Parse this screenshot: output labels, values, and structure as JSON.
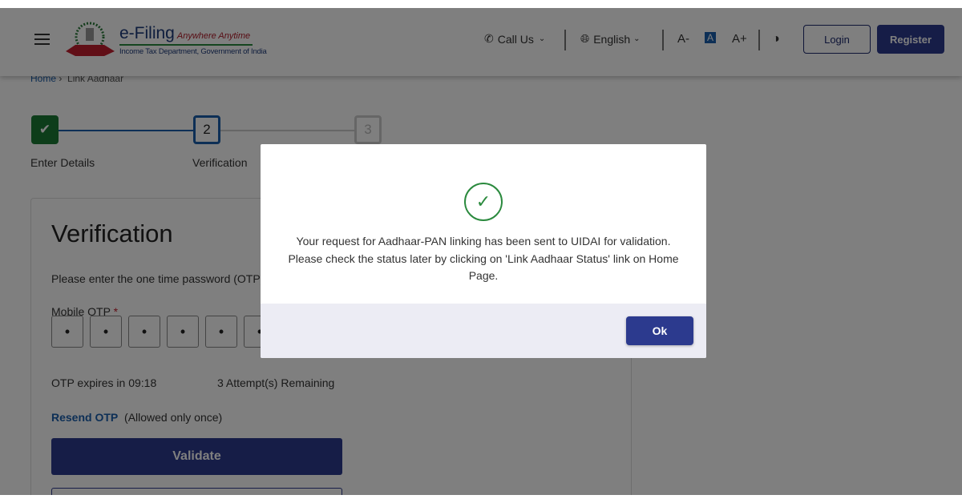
{
  "header": {
    "brand_title": "e-Filing",
    "brand_tagline": "Anywhere Anytime",
    "brand_subtitle": "Income Tax Department, Government of India",
    "call_us": "Call Us",
    "language": "English",
    "font_decrease": "A-",
    "font_normal": "A",
    "font_increase": "A+",
    "login": "Login",
    "register": "Register"
  },
  "breadcrumb": {
    "home": "Home",
    "separator": "›",
    "current": "Link Aadhaar"
  },
  "stepper": {
    "steps": [
      {
        "number": "✔",
        "label": "Enter Details",
        "state": "done"
      },
      {
        "number": "2",
        "label": "Verification",
        "state": "active"
      },
      {
        "number": "3",
        "label": "",
        "state": "pending"
      }
    ]
  },
  "form": {
    "title": "Verification",
    "instruction": "Please enter the one time password (OTP)",
    "otp_label": "Mobile OTP",
    "required_mark": "*",
    "otp_digits": [
      "•",
      "•",
      "•",
      "•",
      "•",
      "•"
    ],
    "expiry": "OTP expires in 09:18",
    "attempts": "3 Attempt(s) Remaining",
    "resend": "Resend OTP",
    "resend_note": "(Allowed only once)",
    "validate": "Validate"
  },
  "modal": {
    "line1": "Your request for Aadhaar-PAN linking has been sent to UIDAI for validation.",
    "line2": "Please check the status later by clicking on 'Link Aadhaar Status' link on Home Page.",
    "ok": "Ok"
  },
  "colors": {
    "primary": "#2c3a8e",
    "success": "#2b8a3e",
    "link": "#1b5fad"
  }
}
